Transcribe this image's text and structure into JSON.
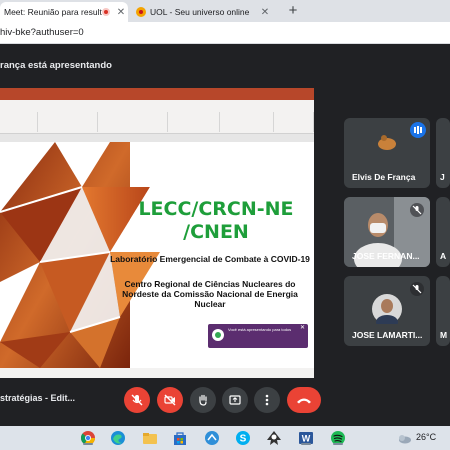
{
  "browser": {
    "tabs": [
      {
        "title": "Meet: Reunião para resultad",
        "active": true
      },
      {
        "title": "UOL - Seu universo online",
        "active": false
      }
    ],
    "url": "hiv-bke?authuser=0"
  },
  "meet": {
    "presenting_banner": "rança está apresentando",
    "meeting_title": "stratégias - Edit...",
    "participants": [
      {
        "name": "Elvis De França",
        "speaking": true
      },
      {
        "name": "JOSE FERNAN..."
      },
      {
        "name": "JOSE LAMARTI..."
      }
    ],
    "partial_tile_letters": [
      "J",
      "A",
      "M"
    ],
    "controls": [
      "mic-off",
      "camera-off",
      "raise-hand",
      "present",
      "more-options",
      "leave-call"
    ]
  },
  "slide": {
    "title_line1": "LECC/CRCN-NE",
    "title_line2": "/CNEN",
    "subtitle1": "Laboratório Emergencial de Combate à COVID-19",
    "subtitle2": "Centro Regional de Ciências Nucleares do Nordeste da Comissão Nacional de Energia Nuclear",
    "toast": "Você está apresentando para todos"
  },
  "taskbar": {
    "temperature": "26°C",
    "apps": [
      "chrome-icon",
      "edge-icon",
      "file-explorer-icon",
      "store-icon",
      "control-panel-icon",
      "skype-icon",
      "inkscape-icon",
      "word-icon",
      "spotify-icon"
    ]
  },
  "colors": {
    "meet_bg": "#202124",
    "accent_red": "#ea4335",
    "slide_title_green": "#1e9e3a",
    "ppt_red": "#b7472a"
  }
}
